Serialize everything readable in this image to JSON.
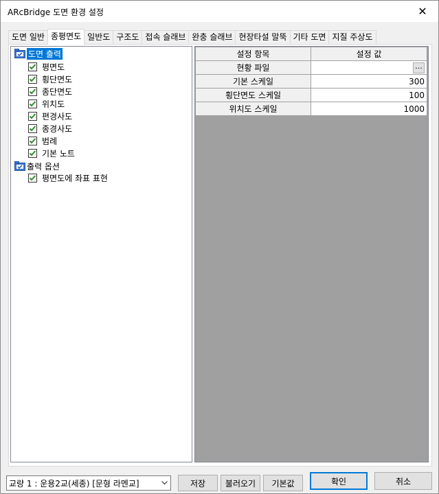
{
  "window": {
    "title": "ARcBridge 도면 환경 설정",
    "close_glyph": "✕"
  },
  "tabs": [
    {
      "label": "도면 일반"
    },
    {
      "label": "종평면도"
    },
    {
      "label": "일반도"
    },
    {
      "label": "구조도"
    },
    {
      "label": "접속 슬래브"
    },
    {
      "label": "완충 슬래브"
    },
    {
      "label": "현장타설 말뚝"
    },
    {
      "label": "기타 도면"
    },
    {
      "label": "지질 주상도"
    }
  ],
  "active_tab": "종평면도",
  "tree": {
    "groups": [
      {
        "label": "도면 출력",
        "icon": "folder-options-icon",
        "selected": true,
        "items": [
          {
            "label": "평면도",
            "checked": true
          },
          {
            "label": "횡단면도",
            "checked": true
          },
          {
            "label": "종단면도",
            "checked": true
          },
          {
            "label": "위치도",
            "checked": true
          },
          {
            "label": "편경사도",
            "checked": true
          },
          {
            "label": "종경사도",
            "checked": true
          },
          {
            "label": "범례",
            "checked": true
          },
          {
            "label": "기본 노트",
            "checked": true
          }
        ]
      },
      {
        "label": "출력 옵션",
        "icon": "folder-options-icon",
        "selected": false,
        "items": [
          {
            "label": "평면도에 좌표 표현",
            "checked": true
          }
        ]
      }
    ]
  },
  "grid": {
    "headers": [
      "설정 항목",
      "설정 값"
    ],
    "rows": [
      {
        "item": "현황 파일",
        "value": "",
        "button": "..."
      },
      {
        "item": "기본 스케일",
        "value": "300"
      },
      {
        "item": "횡단면도 스케일",
        "value": "100"
      },
      {
        "item": "위치도 스케일",
        "value": "1000"
      }
    ]
  },
  "footer": {
    "bridge_select": "교량 1 : 운용2교(세종) [문형 라멘교]",
    "save_label": "저장",
    "load_label": "불러오기",
    "default_label": "기본값",
    "ok_label": "확인",
    "cancel_label": "취소"
  },
  "colors": {
    "selection": "#0078d7",
    "check": "#2e8b2e",
    "grid_background": "#a0a0a0"
  }
}
